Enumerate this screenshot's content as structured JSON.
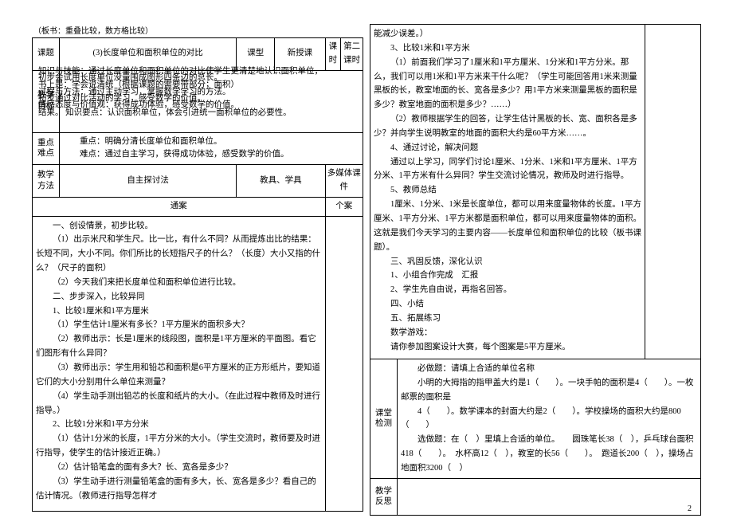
{
  "toprow_left": "（板书：重叠比较，数方格比较）",
  "header": {
    "course_label": "课题",
    "course_value": "(3)长度单位和面积单位的对比",
    "type_label": "课型",
    "type_value": "新授课",
    "period_label": "课时",
    "period_value": "第二课时"
  },
  "overlap": {
    "l1": "知识与技能：通过长度单位和面积单位的对比使学生更清楚地认识面积单位，",
    "l2": "初步会试用长度单位没量围成图形四条边的总长。",
    "l3": "书上是：学会说清统（根据课题的需要带部分；面积）",
    "l4": "过程与方法：通过主动学习，掌握数学学习的方法。",
    "l5": "初步通过对比活动的学习，感受数学的价值。",
    "l6": "情感态度与价值观：获得成功体验，感受数学的价值。",
    "l7": "结果。 知识要点：认识面积单位，体会引进统一面积单位的必要性。"
  },
  "goal_label": "教学目标",
  "keypoint": {
    "label": "重点难点",
    "line1": "重点：明确分清长度单位和面积单位。",
    "line2": "难点：通过自主学习，获得成功体验，感受数学的价值。"
  },
  "method": {
    "label": "教学方法",
    "value": "自主探讨法",
    "tool_label": "教具、学具",
    "tool_value": "多媒体课件"
  },
  "columns": {
    "ta": "通案",
    "ga": "个案"
  },
  "left_content": [
    "一、创设情景，初步比较。",
    "（1）出示米尺和学生尺。比一比，有什么不同？从而提炼出比的结果：长短不同，大小不同。你们所比的长短指尺子的什么？（长度）大小又指的什么？（尺子的面积）",
    "（2）今天我们来把长度单位和面积单位进行比较。",
    "二、步步深入，比较异同",
    "1、比较1厘米和1平方厘米",
    "（1）学生估计1厘米有多长？1平方厘米的面积多大？",
    "（2）教师出示：长是1厘米的线段图，面积是1平方厘米的平面图。看它们图形有什么异同？",
    "（3）教师出示：学生用和铅芯和面积是6平方厘米的正方形纸片，要知道它们的大小分别用什么单位来测量？",
    "（4）学生动手测出铅芯的长度和纸片的大小。（在此过程中教师及时进行指导。）",
    "2、比较1分米和1平方分米",
    "（1）估计1分米的长度，1平方分米的大小。（学生交流时，教师要及时进行指导，使学生的估计接近正确。）",
    "（2）估计铅笔盒的面有多大？长、宽各是多少？",
    "（3）学生动手进行测量铅笔盒的面有多大，长、宽各是多少？看自己的估计情况。（教师进行指导怎样才"
  ],
  "right_content_top": [
    "能减少误差。）",
    "3、比较1米和1平方米",
    "（1）前面我们学习了1厘米和1平方厘米、1分米和1平方分米。那么，我们可以用1米和1平方米来干什么呢？（学生可能回答用1米来测量黑板的长，教室地面的长、宽各是多少？用1平方米来测量黑板的面积是多少？教室地面的面积是多少？……）",
    "（2）教师根据学生的回答，让学生估计黑板的长、宽、面积各是多少？并向学生说明教室的地面的面积大约是60平方米……。",
    "4、通过讨论，解决问题",
    "通过以上学习，同学们讨论1厘米、1分米、1米和1平方厘米、1平方分米、1平方米有什么异同？学生交流讨论情况，教师及时进行指导。",
    "5、教师总结",
    "1厘米、1分米、1米是长度单位，都可以用来度量物体的长度。1平方厘米、1平方分米、1平方米都是面积单位，都可以用来度量物体的面积。这就是我们今天学习的主要内容——长度单位和面积单位的比较（板书课题）。",
    "三、巩固反馈，深化认识",
    "1、小组合作完成　汇报",
    "2、学生先自由说，再指名回答。",
    "四、小结",
    "五、拓展练习",
    "数学游戏：",
    "请你参加图案设计大赛，每个图案是5平方厘米。"
  ],
  "test": {
    "label": "课堂检测",
    "lines": [
      "必做题：请填上合适的单位名称",
      "小明的大拇指的指甲盖大约是1（　　）。一块手帕的面积是4（　　）。一枚邮票的面积是",
      "4（　　）。数学课本的封面大约是2（　　）。学校操场的面积大约是800（　　）",
      "选做题：在（　）里填上合适的单位。　　圆珠笔长38（　），乒乓球台面积418（　　）。　水杯高12（　），教室的长56（　　）。　跑道长200（　），操场占地面积3200（　）"
    ]
  },
  "reflect_label": "教学反思",
  "page_number": "2"
}
